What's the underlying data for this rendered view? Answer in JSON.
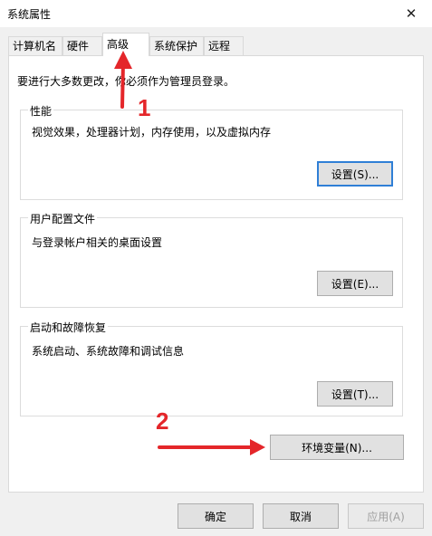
{
  "window": {
    "title": "系统属性"
  },
  "tabs": [
    {
      "label": "计算机名"
    },
    {
      "label": "硬件"
    },
    {
      "label": "高级"
    },
    {
      "label": "系统保护"
    },
    {
      "label": "远程"
    }
  ],
  "notice": "要进行大多数更改，你必须作为管理员登录。",
  "groups": {
    "performance": {
      "legend": "性能",
      "desc": "视觉效果，处理器计划，内存使用，以及虚拟内存",
      "button": "设置(S)..."
    },
    "profile": {
      "legend": "用户配置文件",
      "desc": "与登录帐户相关的桌面设置",
      "button": "设置(E)..."
    },
    "startup": {
      "legend": "启动和故障恢复",
      "desc": "系统启动、系统故障和调试信息",
      "button": "设置(T)..."
    }
  },
  "env_button": "环境变量(N)...",
  "footer": {
    "ok": "确定",
    "cancel": "取消",
    "apply": "应用(A)"
  },
  "annotations": {
    "first": "1",
    "second": "2"
  },
  "colors": {
    "arrow": "#e4262a",
    "focus": "#2f7fd6"
  },
  "icons": {
    "close": "close-icon"
  }
}
